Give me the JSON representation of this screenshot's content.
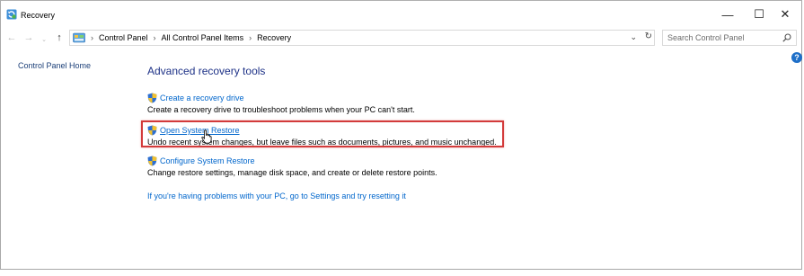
{
  "window": {
    "title": "Recovery",
    "icon": "recovery-icon"
  },
  "caption_buttons": {
    "minimize": "—",
    "maximize": "☐",
    "close": "✕"
  },
  "nav": {
    "back": "←",
    "forward": "→",
    "recent": "⌄",
    "up": "↑"
  },
  "address": {
    "icon": "control-panel-icon",
    "breadcrumbs": [
      "Control Panel",
      "All Control Panel Items",
      "Recovery"
    ],
    "separator": "›",
    "dropdown": "⌄",
    "refresh": "↻"
  },
  "search": {
    "placeholder": "Search Control Panel"
  },
  "sidebar": {
    "home_link": "Control Panel Home"
  },
  "help": {
    "label": "?"
  },
  "main": {
    "heading": "Advanced recovery tools",
    "tasks": [
      {
        "link": "Create a recovery drive",
        "description": "Create a recovery drive to troubleshoot problems when your PC can't start."
      },
      {
        "link": "Open System Restore",
        "description": "Undo recent system changes, but leave files such as documents, pictures, and music unchanged."
      },
      {
        "link": "Configure System Restore",
        "description": "Change restore settings, manage disk space, and create or delete restore points."
      }
    ],
    "reset_link": "If you're having problems with your PC, go to Settings and try resetting it"
  },
  "colors": {
    "heading": "#1e3287",
    "link": "#0066cc",
    "highlight": "#d33b3b"
  }
}
